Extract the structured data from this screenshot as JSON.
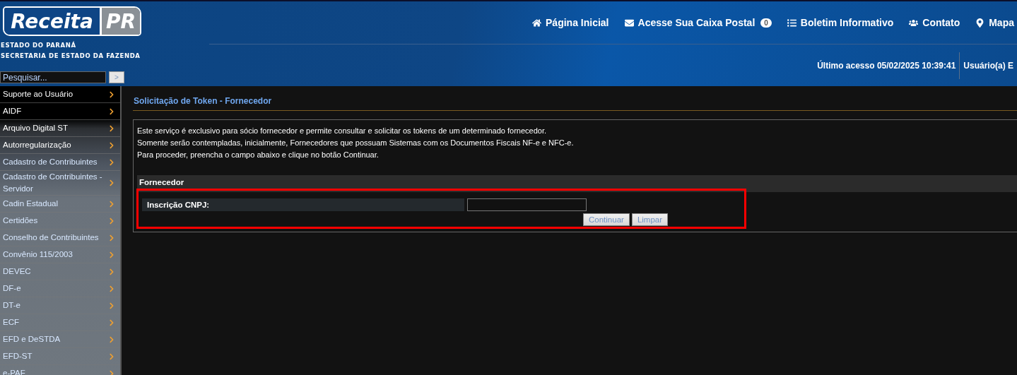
{
  "header": {
    "logo": {
      "word": "Receita",
      "badge": "PR"
    },
    "org_lines": [
      "ESTADO DO PARANÁ",
      "SECRETARIA DE ESTADO DA FAZENDA"
    ],
    "nav": [
      {
        "kind": "home",
        "label": "Página Inicial"
      },
      {
        "kind": "mail",
        "label": "Acesse Sua Caixa Postal",
        "count": "0"
      },
      {
        "kind": "list",
        "label": "Boletim Informativo"
      },
      {
        "kind": "users",
        "label": "Contato"
      },
      {
        "kind": "pin",
        "label": "Mapa"
      }
    ],
    "search": {
      "placeholder": "Pesquisar...",
      "button": ">"
    },
    "last_access": "Último acesso 05/02/2025 10:39:41",
    "user": "Usuário(a) E"
  },
  "sidebar": {
    "items": [
      {
        "label": "Suporte ao Usuário"
      },
      {
        "label": "AIDF"
      },
      {
        "label": "Arquivo Digital ST"
      },
      {
        "label": "Autorregularização"
      },
      {
        "label": "Cadastro de Contribuintes"
      },
      {
        "label": "Cadastro de Contribuintes - Servidor"
      },
      {
        "label": "Cadin Estadual"
      },
      {
        "label": "Certidões"
      },
      {
        "label": "Conselho de Contribuintes"
      },
      {
        "label": "Convênio 115/2003"
      },
      {
        "label": "DEVEC"
      },
      {
        "label": "DF-e"
      },
      {
        "label": "DT-e"
      },
      {
        "label": "ECF"
      },
      {
        "label": "EFD e DeSTDA"
      },
      {
        "label": "EFD-ST"
      },
      {
        "label": "e-PAF"
      }
    ]
  },
  "content": {
    "title": "Solicitação de Token - Fornecedor",
    "intro": [
      "Este serviço é exclusivo para sócio fornecedor e permite consultar e solicitar os tokens de um determinado fornecedor.",
      "Somente serão contempladas, inicialmente, Fornecedores que possuam Sistemas com os Documentos Fiscais NF-e e NFC-e.",
      "Para proceder, preencha o campo abaixo e clique no botão Continuar."
    ],
    "section": "Fornecedor",
    "field": {
      "label": "Inscrição CNPJ:"
    },
    "buttons": [
      {
        "label": "Continuar",
        "disabled": true
      },
      {
        "label": "Limpar",
        "disabled": true
      }
    ]
  }
}
